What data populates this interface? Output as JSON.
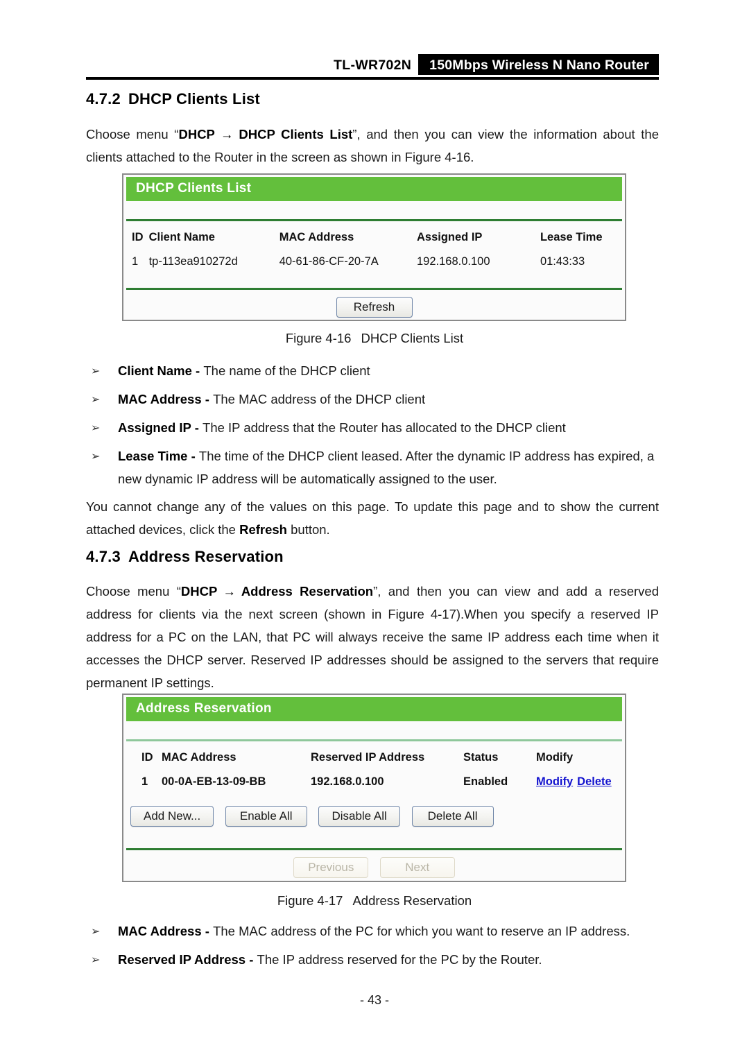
{
  "header": {
    "model": "TL-WR702N",
    "product": "150Mbps  Wireless  N  Nano  Router"
  },
  "sections": {
    "dhcp_clients_list": {
      "number": "4.7.2",
      "title": "DHCP Clients List",
      "intro_prefix": "Choose menu “",
      "intro_menu": "DHCP",
      "intro_arrow": "→",
      "intro_menu2": "DHCP Clients List",
      "intro_suffix": "”, and then you can view the information about the clients attached to the Router in the screen as shown in Figure 4-16."
    },
    "address_reservation": {
      "number": "4.7.3",
      "title": "Address Reservation",
      "intro_prefix": "Choose menu “",
      "intro_menu": "DHCP",
      "intro_arrow": "→",
      "intro_menu2": "Address Reservation",
      "intro_suffix": "”, and then you can view and add a reserved address for clients via the next screen (shown in Figure 4-17).When you specify a reserved IP address for a PC on the LAN, that PC will always receive the same IP address each time when it accesses the DHCP server. Reserved IP addresses should be assigned to the servers that require permanent IP settings."
    }
  },
  "figure_dhcp": {
    "panel_title": "DHCP Clients List",
    "columns": [
      "ID",
      "Client Name",
      "MAC Address",
      "Assigned IP",
      "Lease Time"
    ],
    "rows": [
      {
        "id": "1",
        "client_name": "tp-113ea910272d",
        "mac_address": "40-61-86-CF-20-7A",
        "assigned_ip": "192.168.0.100",
        "lease_time": "01:43:33"
      }
    ],
    "refresh_label": "Refresh",
    "caption_label": "Figure 4-16",
    "caption_text": "DHCP Clients List"
  },
  "figure_reservation": {
    "panel_title": "Address Reservation",
    "columns": [
      "ID",
      "MAC Address",
      "Reserved IP Address",
      "Status",
      "Modify"
    ],
    "rows": [
      {
        "id": "1",
        "mac_address": "00-0A-EB-13-09-BB",
        "reserved_ip": "192.168.0.100",
        "status": "Enabled",
        "modify_link": "Modify",
        "delete_link": "Delete"
      }
    ],
    "buttons": {
      "add_new": "Add New...",
      "enable_all": "Enable All",
      "disable_all": "Disable All",
      "delete_all": "Delete All",
      "previous": "Previous",
      "next": "Next"
    },
    "caption_label": "Figure 4-17",
    "caption_text": "Address Reservation"
  },
  "bullets_dhcp": [
    {
      "marker": "➢",
      "term": "Client Name",
      "dash": " - ",
      "desc": "The name of the DHCP client"
    },
    {
      "marker": "➢",
      "term": "MAC Address",
      "dash": " - ",
      "desc": "The MAC address of the DHCP client"
    },
    {
      "marker": "➢",
      "term": "Assigned IP",
      "dash": " - ",
      "desc": "The IP address that the Router has allocated to the DHCP client"
    },
    {
      "marker": "➢",
      "term": "Lease Time",
      "dash": " - ",
      "desc": "The time of the DHCP client leased. After the dynamic IP address has expired, a new dynamic IP address will be automatically assigned to the user."
    }
  ],
  "note_paragraph": {
    "part1": "You cannot change any of the values on this page. To update this page and to show the current attached devices, click the ",
    "bold": "Refresh",
    "part2": " button."
  },
  "bullets_reservation": [
    {
      "marker": "➢",
      "term": "MAC Address",
      "dash": " - ",
      "desc": "The MAC address of the PC for which you want to reserve an IP address."
    },
    {
      "marker": "➢",
      "term": "Reserved IP Address",
      "dash": " - ",
      "desc": "The IP address reserved for the PC by the Router."
    }
  ],
  "footer": {
    "page_number": "- 43 -"
  },
  "colors": {
    "panel_green": "#63bf3c",
    "rule_green": "#2e7d32",
    "link_blue": "#1212cf",
    "banner_black": "#000000"
  }
}
